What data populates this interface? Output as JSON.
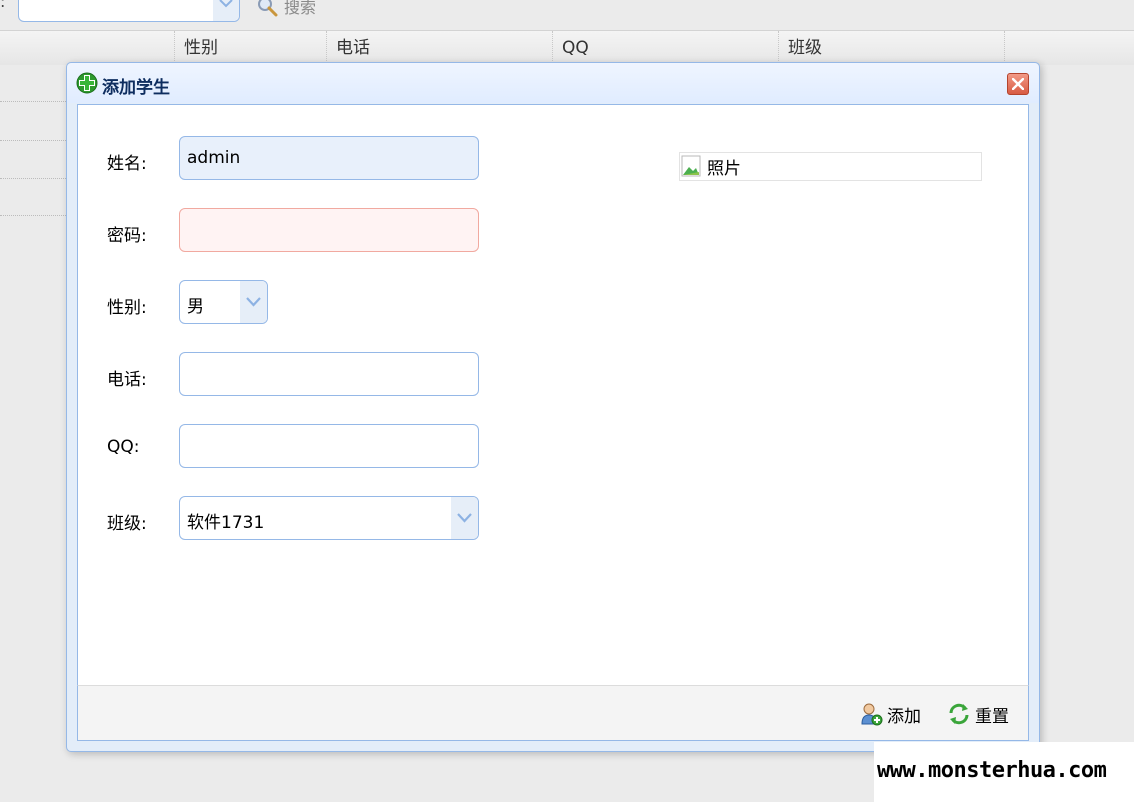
{
  "toolbar": {
    "colon": ":",
    "search_label": "搜索"
  },
  "grid": {
    "columns": [
      "性别",
      "电话",
      "QQ",
      "班级"
    ]
  },
  "dialog": {
    "title": "添加学生",
    "fields": {
      "name": {
        "label": "姓名:",
        "value": "admin"
      },
      "pwd": {
        "label": "密码:",
        "value": ""
      },
      "gender": {
        "label": "性别:",
        "value": "男"
      },
      "phone": {
        "label": "电话:",
        "value": ""
      },
      "qq": {
        "label": "QQ:",
        "value": ""
      },
      "class": {
        "label": "班级:",
        "value": "软件1731"
      }
    },
    "photo_alt": "照片",
    "buttons": {
      "add": "添加",
      "reset": "重置"
    }
  },
  "watermark": "www.monsterhua.com",
  "colors": {
    "border": "#95b8e7",
    "header_text": "#0e2d5f",
    "close": "#d85b43",
    "invalid_bg": "#fff3f3"
  }
}
